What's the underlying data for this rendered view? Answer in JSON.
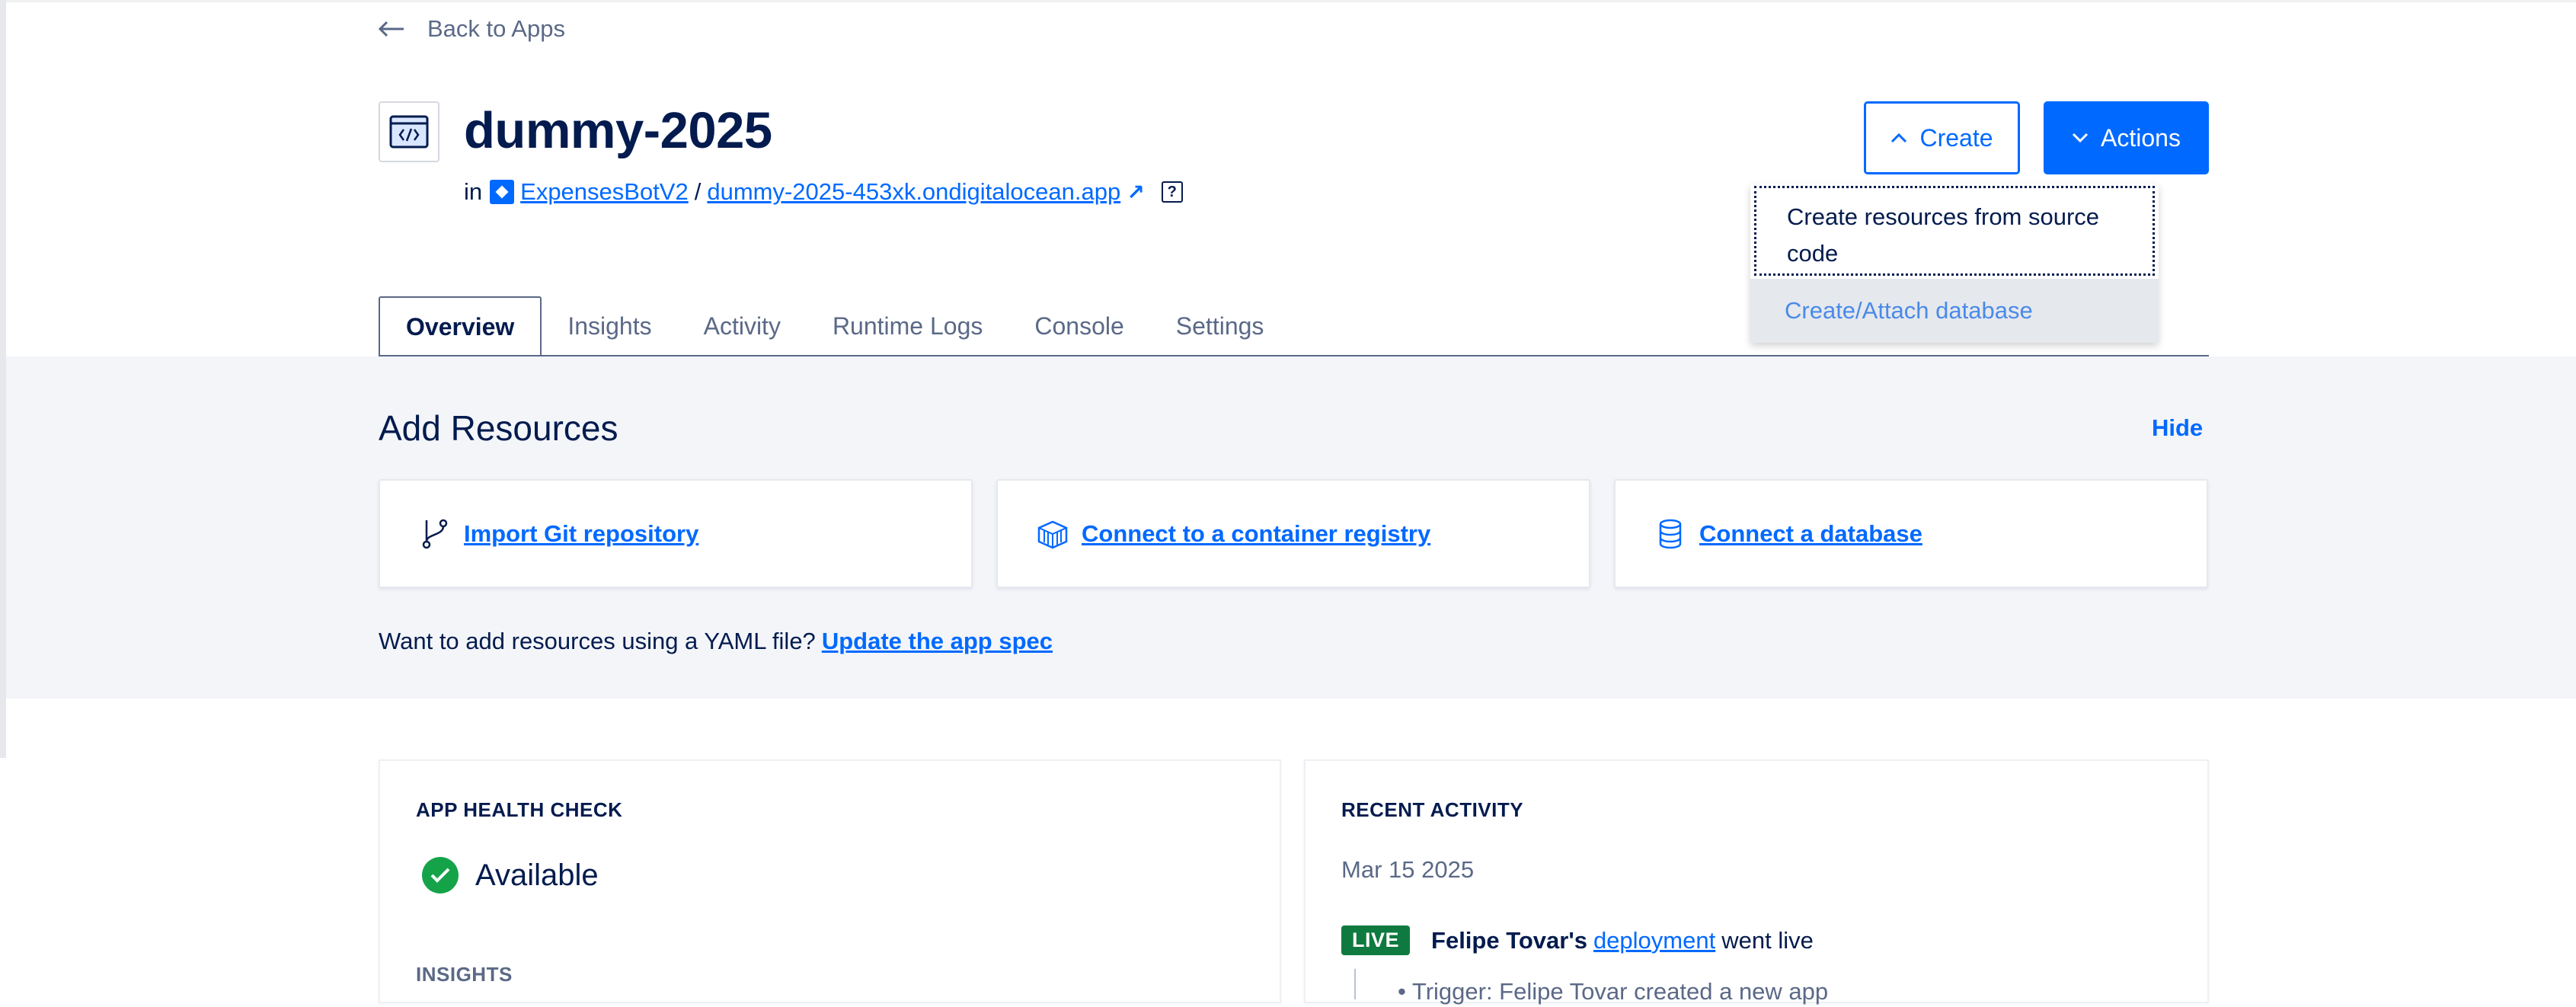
{
  "nav": {
    "back_label": "Back to Apps"
  },
  "app": {
    "title": "dummy-2025",
    "in_label": "in",
    "project_name": "ExpensesBotV2",
    "separator": "/",
    "live_url": "dummy-2025-453xk.ondigitalocean.app",
    "help_glyph": "?"
  },
  "buttons": {
    "create_label": "Create",
    "actions_label": "Actions"
  },
  "create_menu": {
    "items": [
      "Create resources from source code",
      "Create/Attach database"
    ]
  },
  "tabs": [
    "Overview",
    "Insights",
    "Activity",
    "Runtime Logs",
    "Console",
    "Settings"
  ],
  "add_resources": {
    "title": "Add Resources",
    "hide_label": "Hide",
    "cards": [
      {
        "label": "Import Git repository",
        "icon": "git-branch-icon"
      },
      {
        "label": "Connect to a container registry",
        "icon": "container-icon"
      },
      {
        "label": "Connect a database",
        "icon": "database-icon"
      }
    ],
    "yaml_prompt": "Want to add resources using a YAML file?",
    "yaml_link": "Update the app spec"
  },
  "health": {
    "label": "APP HEALTH CHECK",
    "status": "Available",
    "insights_label": "INSIGHTS"
  },
  "recent_activity": {
    "label": "RECENT ACTIVITY",
    "date": "Mar 15 2025",
    "badge": "LIVE",
    "actor": "Felipe Tovar's",
    "link": "deployment",
    "suffix": "went live",
    "trigger": "Trigger: Felipe Tovar created a new app"
  },
  "colors": {
    "accent": "#0069ff",
    "text": "#031b4e",
    "muted": "#5b6987",
    "success": "#15a34a",
    "live": "#0f7a3f",
    "band": "#f3f5f9"
  }
}
